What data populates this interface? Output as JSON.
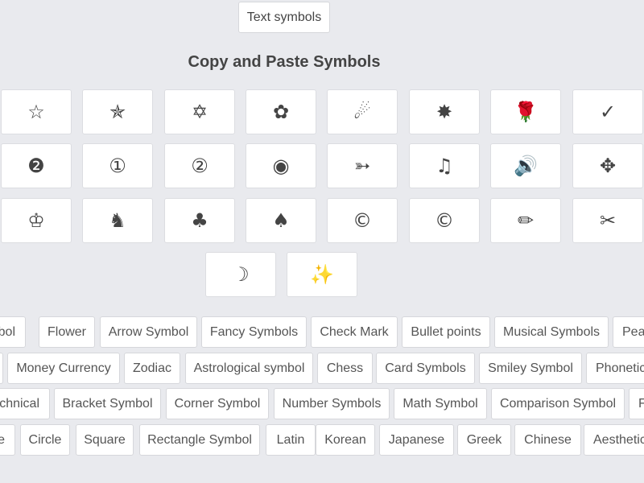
{
  "header": {
    "text_symbols_button": "Text symbols",
    "title": "Copy and Paste Symbols"
  },
  "symbols": [
    {
      "name": "white-star-icon",
      "glyph": "☆"
    },
    {
      "name": "outlined-star-icon",
      "glyph": "✯"
    },
    {
      "name": "star-of-david-icon",
      "glyph": "✡"
    },
    {
      "name": "flower-icon",
      "glyph": "✿"
    },
    {
      "name": "shooting-star-icon",
      "glyph": "☄"
    },
    {
      "name": "glowing-star-icon",
      "glyph": "✸"
    },
    {
      "name": "rose-icon",
      "glyph": "🌹"
    },
    {
      "name": "check-mark-icon",
      "glyph": "✓"
    },
    {
      "name": "negative-circled-two-icon",
      "glyph": "❷"
    },
    {
      "name": "circled-one-icon",
      "glyph": "①"
    },
    {
      "name": "circled-two-icon",
      "glyph": "②"
    },
    {
      "name": "fisheye-icon",
      "glyph": "◉"
    },
    {
      "name": "arrow-icon",
      "glyph": "➳"
    },
    {
      "name": "music-note-icon",
      "glyph": "♫"
    },
    {
      "name": "speaker-icon",
      "glyph": "🔊"
    },
    {
      "name": "checkered-cross-icon",
      "glyph": "✥"
    },
    {
      "name": "white-king-icon",
      "glyph": "♔"
    },
    {
      "name": "black-knight-icon",
      "glyph": "♞"
    },
    {
      "name": "club-suit-icon",
      "glyph": "♣"
    },
    {
      "name": "spade-suit-icon",
      "glyph": "♠"
    },
    {
      "name": "copyright-icon",
      "glyph": "©"
    },
    {
      "name": "copyright-alt-icon",
      "glyph": "©"
    },
    {
      "name": "pencil-icon",
      "glyph": "✏"
    },
    {
      "name": "scissors-icon",
      "glyph": "✂"
    },
    {
      "name": "crescent-moon-icon",
      "glyph": "☽"
    },
    {
      "name": "galaxy-icon",
      "glyph": "✨"
    }
  ],
  "categories": [
    [
      "mbol",
      "Flower",
      "Arrow Symbol",
      "Fancy Symbols",
      "Check Mark",
      "Bullet points",
      "Musical Symbols",
      "Pea"
    ],
    [
      "",
      "Money Currency",
      "Zodiac",
      "Astrological symbol",
      "Chess",
      "Card Symbols",
      "Smiley Symbol",
      "Phonetic"
    ],
    [
      "chnical",
      "Bracket Symbol",
      "Corner Symbol",
      "Number Symbols",
      "Math Symbol",
      "Comparison Symbol",
      "F"
    ],
    [
      "e",
      "Circle",
      "Square",
      "Rectangle Symbol",
      "Latin",
      "Korean",
      "Japanese",
      "Greek",
      "Chinese",
      "Aesthetic"
    ]
  ]
}
